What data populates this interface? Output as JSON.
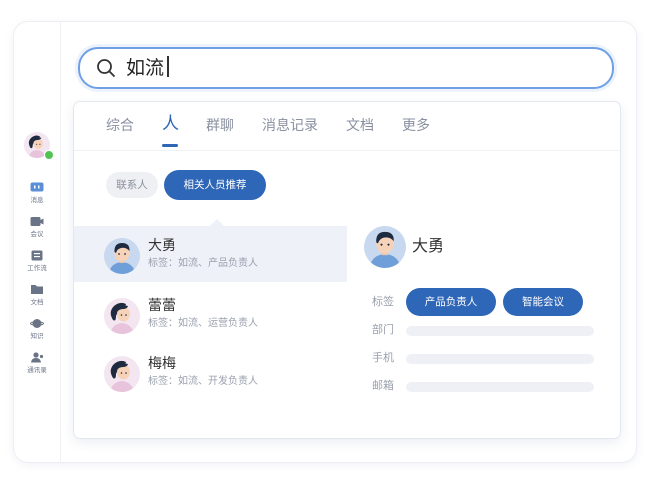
{
  "search": {
    "query": "如流"
  },
  "sidebar": {
    "items": [
      {
        "label": "消息",
        "icon": "message-icon"
      },
      {
        "label": "会议",
        "icon": "meeting-icon"
      },
      {
        "label": "工作流",
        "icon": "workflow-icon"
      },
      {
        "label": "文档",
        "icon": "document-icon"
      },
      {
        "label": "知识",
        "icon": "knowledge-icon"
      },
      {
        "label": "通讯录",
        "icon": "contacts-icon"
      }
    ]
  },
  "tabs": [
    "综合",
    "人",
    "群聊",
    "消息记录",
    "文档",
    "更多"
  ],
  "active_tab": "人",
  "filters": {
    "contacts": "联系人",
    "recommended": "相关人员推荐"
  },
  "results": [
    {
      "name": "大勇",
      "tags": "标签：如流、产品负责人",
      "avatar": "man-avatar"
    },
    {
      "name": "蕾蕾",
      "tags": "标签：如流、运营负责人",
      "avatar": "woman-avatar"
    },
    {
      "name": "梅梅",
      "tags": "标签：如流、开发负责人",
      "avatar": "woman-avatar"
    }
  ],
  "detail": {
    "name": "大勇",
    "tag_label": "标签",
    "tags": [
      "产品负责人",
      "智能会议"
    ],
    "department_label": "部门",
    "phone_label": "手机",
    "email_label": "邮箱"
  },
  "colors": {
    "accent": "#2f67b8",
    "search_border": "#6f9fe6",
    "selected_row": "#eef1f8",
    "online": "#52c352"
  }
}
